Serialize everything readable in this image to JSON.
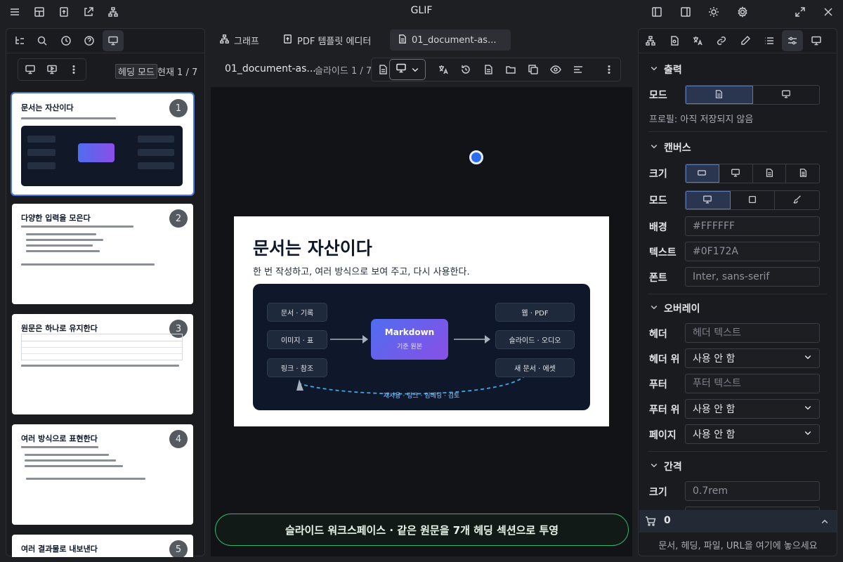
{
  "app": {
    "title": "GLIF"
  },
  "tabs": [
    {
      "label": "그래프"
    },
    {
      "label": "PDF 템플릿 에디터"
    },
    {
      "label": "01_document-as..."
    }
  ],
  "left": {
    "mode_badge": "헤딩 모드",
    "page_indicator": "현재 1 / 7",
    "thumbs": [
      {
        "num": "1",
        "title": "문서는 자산이다"
      },
      {
        "num": "2",
        "title": "다양한 입력을 모은다"
      },
      {
        "num": "3",
        "title": "원문은 하나로 유지한다"
      },
      {
        "num": "4",
        "title": "여러 방식으로 표현한다"
      },
      {
        "num": "5",
        "title": "여러 결과물로 내보낸다"
      }
    ]
  },
  "editor": {
    "doc_name": "01_document-as...",
    "slide_counter": "슬라이드 1 / 7"
  },
  "slide": {
    "title": "문서는 자산이다",
    "subtitle": "한 번 작성하고, 여러 방식으로 보여 주고, 다시 사용한다.",
    "diagram": {
      "inputs": [
        "문서 · 기록",
        "이미지 · 표",
        "링크 · 참조"
      ],
      "center_title": "Markdown",
      "center_sub": "기준 원본",
      "outputs": [
        "웹 · PDF",
        "슬라이드 · 오디오",
        "새 문서 · 에셋"
      ],
      "loop_label": "재사용 · 링크 · 임베딩 · 검토"
    }
  },
  "banner": {
    "text": "슬라이드 워크스페이스 · 같은 원문을 7개 헤딩 섹션으로 투영"
  },
  "right": {
    "sections": {
      "output": "출력",
      "canvas": "캔버스",
      "overlay": "오버레이",
      "spacing": "간격"
    },
    "labels": {
      "mode": "모드",
      "size": "크기",
      "canvas_mode": "모드",
      "background": "배경",
      "text": "텍스트",
      "font": "폰트",
      "header": "헤더",
      "header_pos": "헤더 위치",
      "footer": "푸터",
      "footer_pos": "푸터 위치",
      "page": "페이지 번호",
      "spacing_size": "크기"
    },
    "profile_note": "프로필: 아직 저장되지 않음",
    "background_value": "#FFFFFF",
    "text_value": "#0F172A",
    "font_value": "Inter, sans-serif",
    "header_placeholder": "헤더 텍스트",
    "footer_placeholder": "푸터 텍스트",
    "header_pos_value": "사용 안 함",
    "footer_pos_value": "사용 안 함",
    "page_value": "사용 안 함",
    "spacing_value": "0.7rem",
    "cart_count": "0",
    "drop_hint": "문서, 헤딩, 파일, URL을 여기에 놓으세요"
  },
  "colors": {
    "accent": "#4a79d8",
    "brand": "#7c5cf0",
    "banner_border": "#2fb56e"
  }
}
